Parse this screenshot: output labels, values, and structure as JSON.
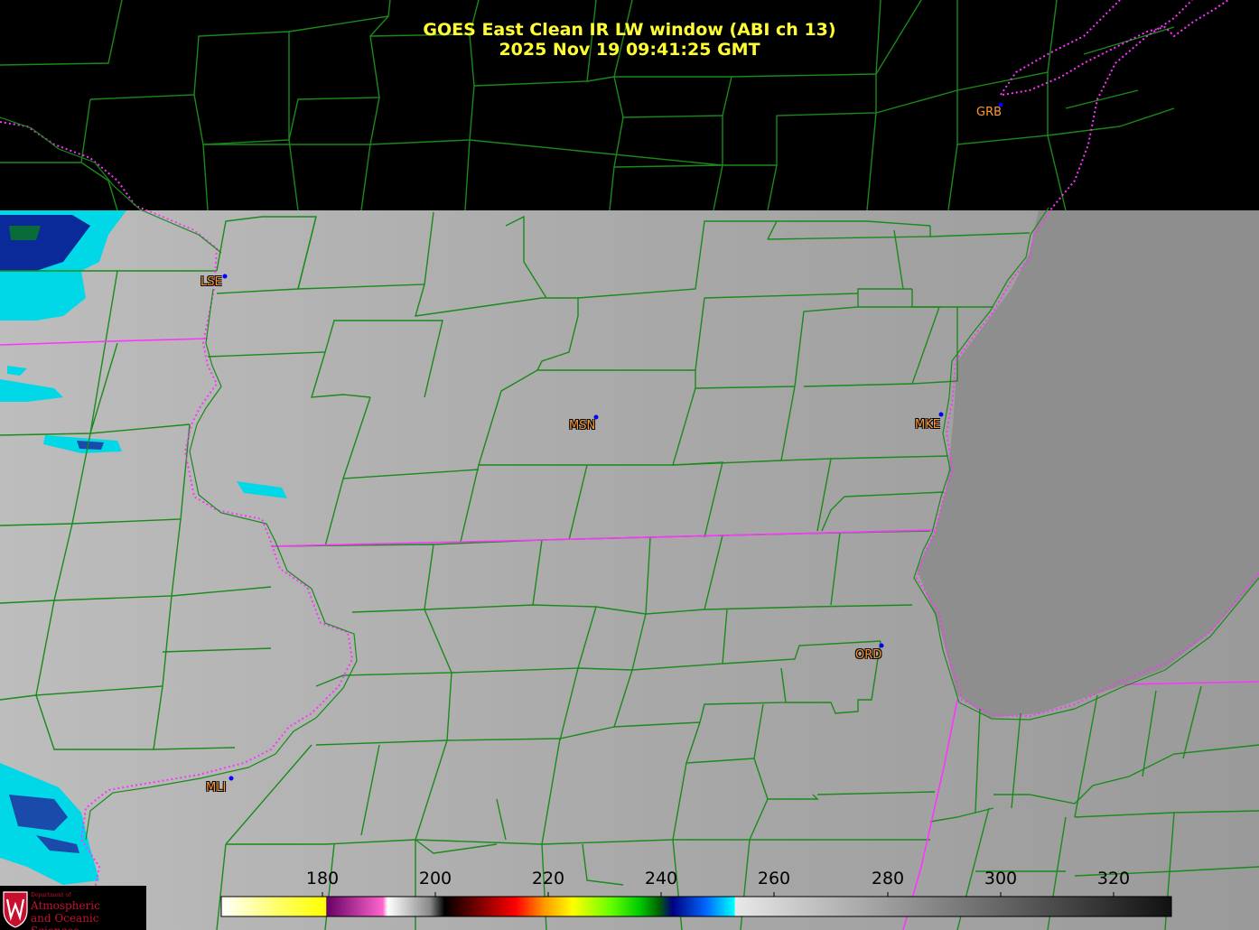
{
  "title": {
    "line1": "GOES East Clean IR LW window (ABI ch 13)",
    "line2": "2025 Nov 19  09:41:25 GMT"
  },
  "stations": [
    {
      "id": "GRB"
    },
    {
      "id": "LSE"
    },
    {
      "id": "MSN"
    },
    {
      "id": "MKE"
    },
    {
      "id": "ORD"
    },
    {
      "id": "MLI"
    }
  ],
  "colorbar": {
    "ticks": [
      "180",
      "200",
      "220",
      "240",
      "260",
      "280",
      "300",
      "320"
    ],
    "range": [
      163,
      331
    ]
  },
  "logo": {
    "line1": "Department of",
    "line2": "Atmospheric",
    "line3": "and Oceanic Sciences"
  },
  "colors": {
    "title": "#ffff33",
    "county_lines": "#1a8a1a",
    "state_lines": "#ff33ff",
    "station_label": "#ff9933",
    "station_dot": "#0000ff"
  }
}
